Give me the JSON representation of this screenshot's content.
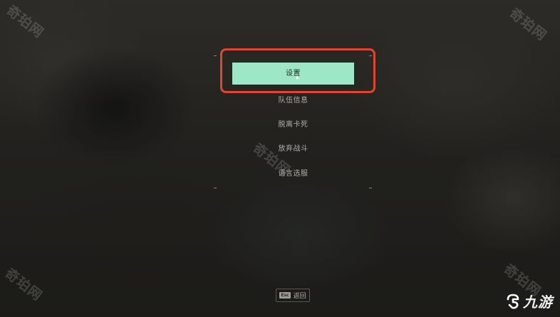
{
  "menu": {
    "items": [
      {
        "label": "设置",
        "selected": true
      },
      {
        "label": "队伍信息",
        "selected": false
      },
      {
        "label": "脱离卡死",
        "selected": false
      },
      {
        "label": "放弃战斗",
        "selected": false
      },
      {
        "label": "语言选服",
        "selected": false
      }
    ]
  },
  "footer": {
    "esc_key": "Esc",
    "back_label": "返回"
  },
  "watermarks": {
    "text": "奇珀网"
  },
  "logo": {
    "text": "九游",
    "icon": "jiuyou-logo-icon"
  },
  "colors": {
    "selected_bg": "#9de6c6",
    "highlight_border": "#e2452e",
    "menu_text": "#d7d7cd"
  }
}
